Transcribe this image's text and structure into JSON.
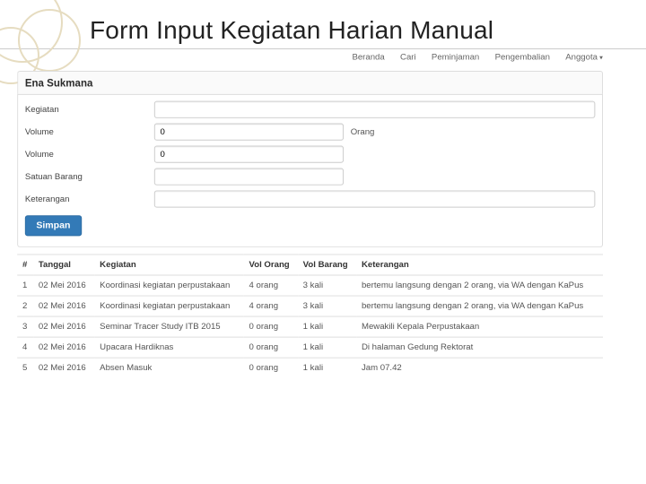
{
  "title": "Form Input Kegiatan Harian Manual",
  "nav": {
    "items": [
      "Beranda",
      "Cari",
      "Peminjaman",
      "Pengembalian",
      "Anggota"
    ]
  },
  "panel": {
    "heading": "Ena Sukmana"
  },
  "form": {
    "kegiatan": {
      "label": "Kegiatan",
      "value": ""
    },
    "vol_orang": {
      "label": "Volume",
      "value": "0",
      "unit": "Orang"
    },
    "vol_barang": {
      "label": "Volume",
      "value": "0"
    },
    "satuan": {
      "label": "Satuan Barang",
      "value": ""
    },
    "keterangan": {
      "label": "Keterangan",
      "value": ""
    },
    "save_label": "Simpan"
  },
  "table": {
    "headers": {
      "no": "#",
      "tanggal": "Tanggal",
      "kegiatan": "Kegiatan",
      "vol_orang": "Vol Orang",
      "vol_barang": "Vol Barang",
      "keterangan": "Keterangan"
    },
    "rows": [
      {
        "no": "1",
        "tanggal": "02 Mei 2016",
        "kegiatan": "Koordinasi kegiatan perpustakaan",
        "vol_orang": "4 orang",
        "vol_barang": "3 kali",
        "keterangan": "bertemu langsung dengan 2 orang, via WA dengan KaPus"
      },
      {
        "no": "2",
        "tanggal": "02 Mei 2016",
        "kegiatan": "Koordinasi kegiatan perpustakaan",
        "vol_orang": "4 orang",
        "vol_barang": "3 kali",
        "keterangan": "bertemu langsung dengan 2 orang, via WA dengan KaPus"
      },
      {
        "no": "3",
        "tanggal": "02 Mei 2016",
        "kegiatan": "Seminar Tracer Study ITB 2015",
        "vol_orang": "0 orang",
        "vol_barang": "1 kali",
        "keterangan": "Mewakili Kepala Perpustakaan"
      },
      {
        "no": "4",
        "tanggal": "02 Mei 2016",
        "kegiatan": "Upacara Hardiknas",
        "vol_orang": "0 orang",
        "vol_barang": "1 kali",
        "keterangan": "Di halaman Gedung Rektorat"
      },
      {
        "no": "5",
        "tanggal": "02 Mei 2016",
        "kegiatan": "Absen Masuk",
        "vol_orang": "0 orang",
        "vol_barang": "1 kali",
        "keterangan": "Jam 07.42"
      }
    ]
  }
}
